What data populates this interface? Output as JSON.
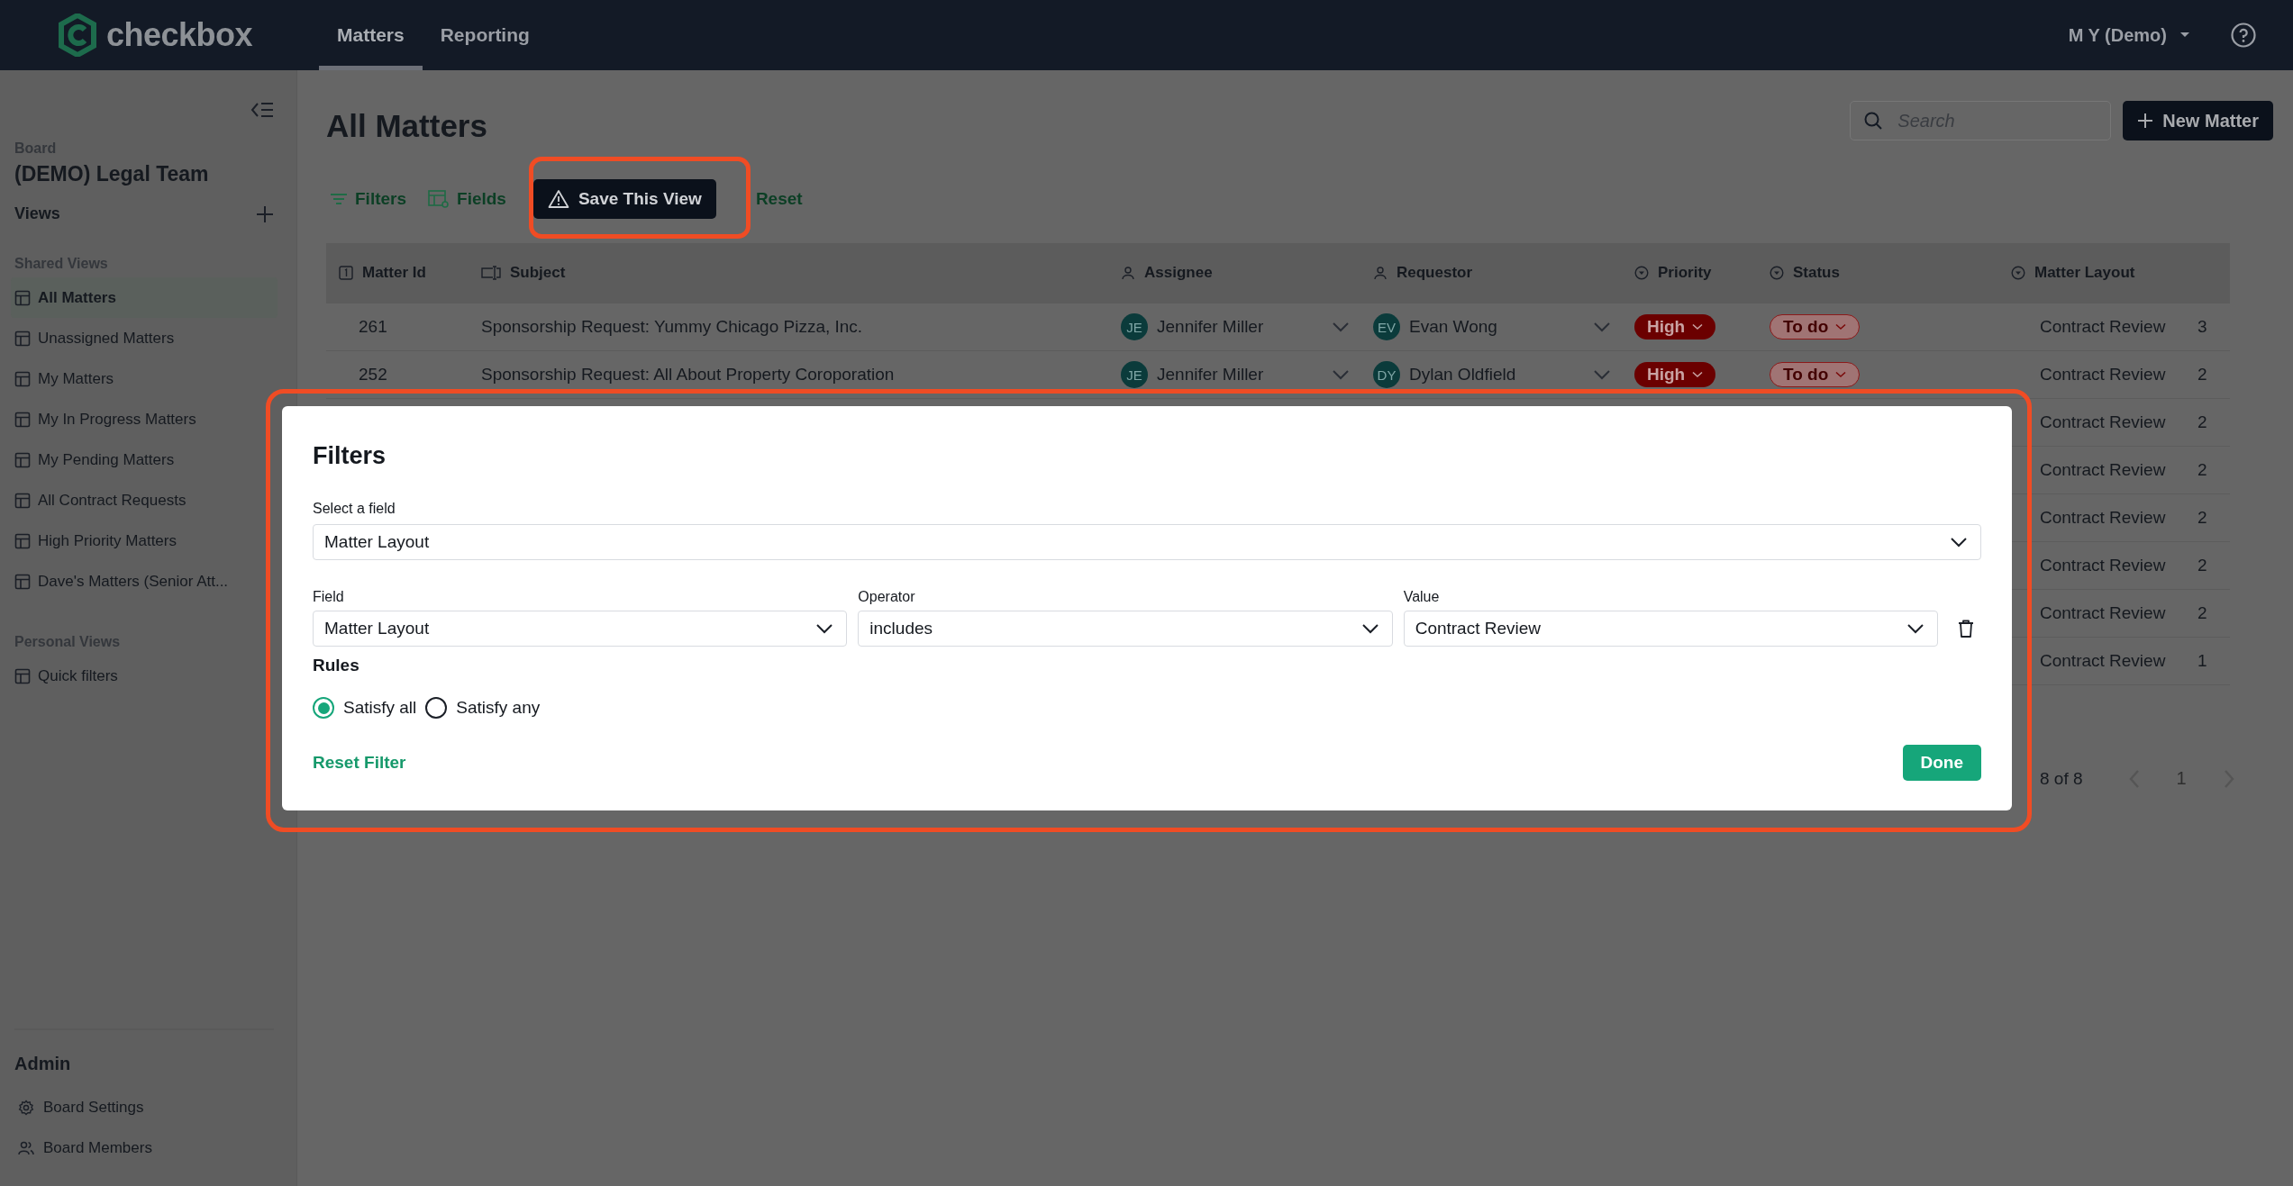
{
  "topbar": {
    "logo": "checkbox",
    "tabs": [
      {
        "label": "Matters",
        "selected": true
      },
      {
        "label": "Reporting",
        "selected": false
      }
    ],
    "user": "M Y (Demo)"
  },
  "sidebar": {
    "board_label": "Board",
    "board_name": "(DEMO) Legal Team",
    "views_label": "Views",
    "sections": [
      {
        "title": "Shared Views",
        "items": [
          {
            "label": "All Matters",
            "selected": true
          },
          {
            "label": "Unassigned Matters",
            "selected": false
          },
          {
            "label": "My Matters",
            "selected": false
          },
          {
            "label": "My In Progress Matters",
            "selected": false
          },
          {
            "label": "My Pending Matters",
            "selected": false
          },
          {
            "label": "All Contract Requests",
            "selected": false
          },
          {
            "label": "High Priority Matters",
            "selected": false
          },
          {
            "label": "Dave's Matters (Senior Att...",
            "selected": false
          }
        ]
      },
      {
        "title": "Personal Views",
        "items": [
          {
            "label": "Quick filters",
            "selected": false
          }
        ]
      }
    ],
    "admin": {
      "title": "Admin",
      "items": [
        {
          "label": "Board Settings",
          "kind": "settings"
        },
        {
          "label": "Board Members",
          "kind": "members"
        }
      ]
    }
  },
  "page": {
    "title": "All Matters",
    "search": {
      "placeholder": "Search"
    },
    "new_button": "New Matter",
    "toolbar": [
      {
        "label": "Filters",
        "kind": "filters"
      },
      {
        "label": "Fields",
        "kind": "fields"
      },
      {
        "label": "Save This View",
        "kind": "save"
      },
      {
        "label": "Reset",
        "kind": "reset"
      }
    ]
  },
  "table": {
    "columns": [
      {
        "label": "Matter Id",
        "kind": "id"
      },
      {
        "label": "Subject",
        "kind": "text"
      },
      {
        "label": "Assignee",
        "kind": "person"
      },
      {
        "label": "Requestor",
        "kind": "person"
      },
      {
        "label": "Priority",
        "kind": "select"
      },
      {
        "label": "Status",
        "kind": "select"
      },
      {
        "label": "Matter Layout",
        "kind": "select"
      }
    ],
    "rows": [
      {
        "matter_id": "261",
        "subject": "Sponsorship Request: Yummy Chicago Pizza, Inc.",
        "assignee": {
          "initials": "JE",
          "name": "Jennifer Miller"
        },
        "requestor": {
          "initials": "EV",
          "name": "Evan Wong"
        },
        "priority": "High",
        "status": "To do",
        "matter_layout": "Contract Review",
        "column_8": "3"
      },
      {
        "matter_id": "252",
        "subject": "Sponsorship Request: All About Property Coroporation",
        "assignee": {
          "initials": "JE",
          "name": "Jennifer Miller"
        },
        "requestor": {
          "initials": "DY",
          "name": "Dylan Oldfield"
        },
        "priority": "High",
        "status": "To do",
        "matter_layout": "Contract Review",
        "column_8": "2"
      },
      {
        "matter_layout": "Contract Review",
        "column_8": "2"
      },
      {
        "matter_layout": "Contract Review",
        "column_8": "2"
      },
      {
        "matter_layout": "Contract Review",
        "column_8": "2"
      },
      {
        "matter_layout": "Contract Review",
        "column_8": "2"
      },
      {
        "matter_layout": "Contract Review",
        "column_8": "2"
      },
      {
        "matter_layout": "Contract Review",
        "column_8": "1"
      }
    ]
  },
  "pagination": {
    "summary": "8 of 8",
    "page": "1"
  },
  "modal": {
    "title": "Filters",
    "select_label": "Select a field",
    "select_value": "Matter Layout",
    "condition": [
      {
        "label": "Field",
        "value": "Matter Layout"
      },
      {
        "label": "Operator",
        "value": "includes"
      },
      {
        "label": "Value",
        "value": "Contract Review"
      }
    ],
    "rules_label": "Rules",
    "rules": [
      {
        "label": "Satisfy all",
        "selected": true
      },
      {
        "label": "Satisfy any",
        "selected": false
      }
    ],
    "reset": "Reset Filter",
    "done": "Done"
  }
}
